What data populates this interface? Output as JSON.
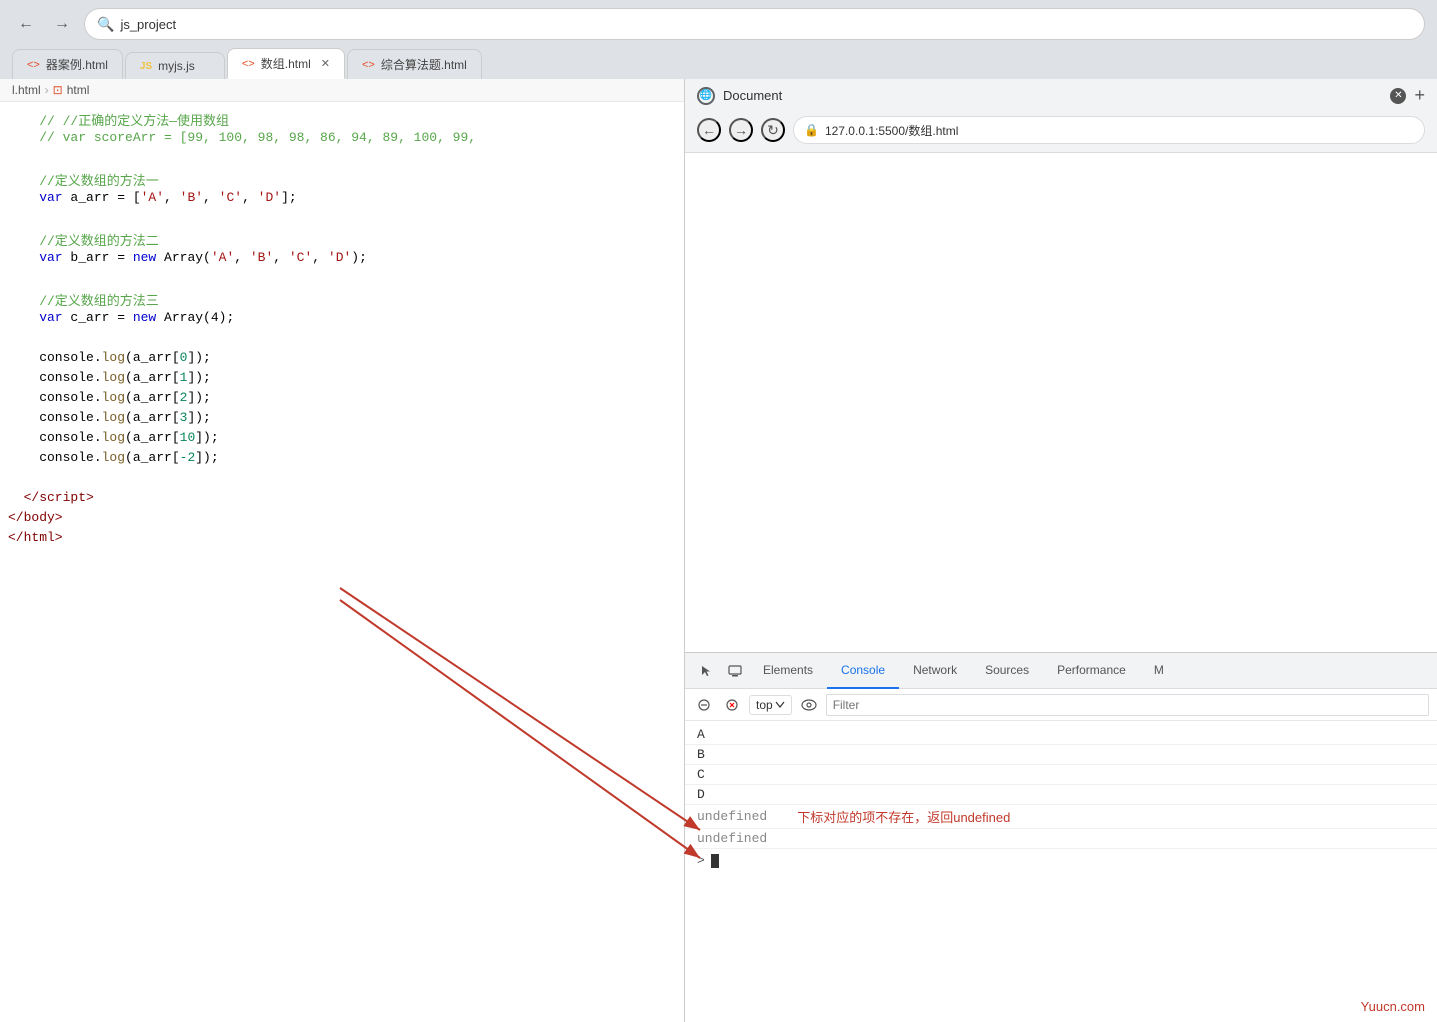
{
  "browser": {
    "title": "js_project",
    "back_btn": "←",
    "forward_btn": "→",
    "search_placeholder": "js_project"
  },
  "tabs": [
    {
      "id": "tab1",
      "label": "器案例.html",
      "icon": "<>",
      "type": "html",
      "active": false,
      "closable": false
    },
    {
      "id": "tab2",
      "label": "myjs.js",
      "icon": "JS",
      "type": "js",
      "active": false,
      "closable": false
    },
    {
      "id": "tab3",
      "label": "数组.html",
      "icon": "<>",
      "type": "html",
      "active": true,
      "closable": true
    },
    {
      "id": "tab4",
      "label": "综合算法题.html",
      "icon": "<>",
      "type": "html",
      "active": false,
      "closable": false
    }
  ],
  "breadcrumb": {
    "parts": [
      "l.html",
      "html"
    ]
  },
  "code_lines": [
    {
      "num": "",
      "content": ""
    },
    {
      "num": "",
      "tokens": [
        {
          "text": "    // //正确的定义方法—使用数组",
          "class": "c-comment"
        }
      ]
    },
    {
      "num": "",
      "tokens": [
        {
          "text": "    // var scoreArr = [99, 100, 98, 98, 86, 94, 89, 100, 99,",
          "class": "c-comment"
        }
      ]
    },
    {
      "num": "",
      "content": ""
    },
    {
      "num": "",
      "tokens": [
        {
          "text": "    //定义数组的方法一",
          "class": "c-comment"
        }
      ]
    },
    {
      "num": "",
      "tokens": [
        {
          "text": "    ",
          "class": ""
        },
        {
          "text": "var",
          "class": "c-keyword"
        },
        {
          "text": " a_arr = [",
          "class": ""
        },
        {
          "text": "'A'",
          "class": "c-string"
        },
        {
          "text": ", ",
          "class": ""
        },
        {
          "text": "'B'",
          "class": "c-string"
        },
        {
          "text": ", ",
          "class": ""
        },
        {
          "text": "'C'",
          "class": "c-string"
        },
        {
          "text": ", ",
          "class": ""
        },
        {
          "text": "'D'",
          "class": "c-string"
        },
        {
          "text": "];",
          "class": ""
        }
      ]
    },
    {
      "num": "",
      "content": ""
    },
    {
      "num": "",
      "tokens": [
        {
          "text": "    //定义数组的方法二",
          "class": "c-comment"
        }
      ]
    },
    {
      "num": "",
      "tokens": [
        {
          "text": "    ",
          "class": ""
        },
        {
          "text": "var",
          "class": "c-keyword"
        },
        {
          "text": " b_arr = ",
          "class": ""
        },
        {
          "text": "new",
          "class": "c-keyword"
        },
        {
          "text": " Array(",
          "class": ""
        },
        {
          "text": "'A'",
          "class": "c-string"
        },
        {
          "text": ", ",
          "class": ""
        },
        {
          "text": "'B'",
          "class": "c-string"
        },
        {
          "text": ", ",
          "class": ""
        },
        {
          "text": "'C'",
          "class": "c-string"
        },
        {
          "text": ", ",
          "class": ""
        },
        {
          "text": "'D'",
          "class": "c-string"
        },
        {
          "text": ");",
          "class": ""
        }
      ]
    },
    {
      "num": "",
      "content": ""
    },
    {
      "num": "",
      "tokens": [
        {
          "text": "    //定义数组的方法三",
          "class": "c-comment"
        }
      ]
    },
    {
      "num": "",
      "tokens": [
        {
          "text": "    ",
          "class": ""
        },
        {
          "text": "var",
          "class": "c-keyword"
        },
        {
          "text": " c_arr = ",
          "class": ""
        },
        {
          "text": "new",
          "class": "c-keyword"
        },
        {
          "text": " Array(4);",
          "class": ""
        }
      ]
    },
    {
      "num": "",
      "content": ""
    },
    {
      "num": "",
      "tokens": [
        {
          "text": "    console.",
          "class": ""
        },
        {
          "text": "log",
          "class": "c-func"
        },
        {
          "text": "(a_arr[",
          "class": ""
        },
        {
          "text": "0",
          "class": "c-num"
        },
        {
          "text": "]);",
          "class": ""
        }
      ]
    },
    {
      "num": "",
      "tokens": [
        {
          "text": "    console.",
          "class": ""
        },
        {
          "text": "log",
          "class": "c-func"
        },
        {
          "text": "(a_arr[",
          "class": ""
        },
        {
          "text": "1",
          "class": "c-num"
        },
        {
          "text": "]);",
          "class": ""
        }
      ]
    },
    {
      "num": "",
      "tokens": [
        {
          "text": "    console.",
          "class": ""
        },
        {
          "text": "log",
          "class": "c-func"
        },
        {
          "text": "(a_arr[",
          "class": ""
        },
        {
          "text": "2",
          "class": "c-num"
        },
        {
          "text": "]);",
          "class": ""
        }
      ]
    },
    {
      "num": "",
      "tokens": [
        {
          "text": "    console.",
          "class": ""
        },
        {
          "text": "log",
          "class": "c-func"
        },
        {
          "text": "(a_arr[",
          "class": ""
        },
        {
          "text": "3",
          "class": "c-num"
        },
        {
          "text": "]);",
          "class": ""
        }
      ]
    },
    {
      "num": "",
      "tokens": [
        {
          "text": "    console.",
          "class": ""
        },
        {
          "text": "log",
          "class": "c-func"
        },
        {
          "text": "(a_arr[",
          "class": ""
        },
        {
          "text": "10",
          "class": "c-num"
        },
        {
          "text": "]);",
          "class": ""
        }
      ]
    },
    {
      "num": "",
      "tokens": [
        {
          "text": "    console.",
          "class": ""
        },
        {
          "text": "log",
          "class": "c-func"
        },
        {
          "text": "(a_arr[",
          "class": ""
        },
        {
          "text": "-2",
          "class": "c-num"
        },
        {
          "text": "]);",
          "class": ""
        }
      ]
    },
    {
      "num": "",
      "content": ""
    },
    {
      "num": "",
      "tokens": [
        {
          "text": "  </",
          "class": "c-tag"
        },
        {
          "text": "script",
          "class": "c-tag"
        },
        {
          "text": ">",
          "class": "c-tag"
        }
      ]
    },
    {
      "num": "",
      "tokens": [
        {
          "text": "</",
          "class": "c-tag"
        },
        {
          "text": "body",
          "class": "c-tag"
        },
        {
          "text": ">",
          "class": "c-tag"
        }
      ]
    },
    {
      "num": "",
      "tokens": [
        {
          "text": "</",
          "class": "c-tag"
        },
        {
          "text": "html",
          "class": "c-tag"
        },
        {
          "text": ">",
          "class": "c-tag"
        }
      ]
    }
  ],
  "preview_browser": {
    "title": "Document",
    "url": "127.0.0.1:5500/数组.html",
    "back": "←",
    "forward": "→",
    "refresh": "↻"
  },
  "devtools": {
    "tabs": [
      "Elements",
      "Console",
      "Network",
      "Sources",
      "Performance",
      "M"
    ],
    "active_tab": "Console",
    "toolbar": {
      "top_label": "top",
      "filter_placeholder": "Filter"
    },
    "console_output": [
      {
        "text": "A",
        "type": "normal"
      },
      {
        "text": "B",
        "type": "normal"
      },
      {
        "text": "C",
        "type": "normal"
      },
      {
        "text": "D",
        "type": "normal"
      },
      {
        "text": "undefined",
        "type": "undefined"
      },
      {
        "text": "undefined",
        "type": "undefined"
      }
    ],
    "annotation_text": "下标对应的项不存在，返回undefined"
  },
  "watermark": "Yuucn.com"
}
